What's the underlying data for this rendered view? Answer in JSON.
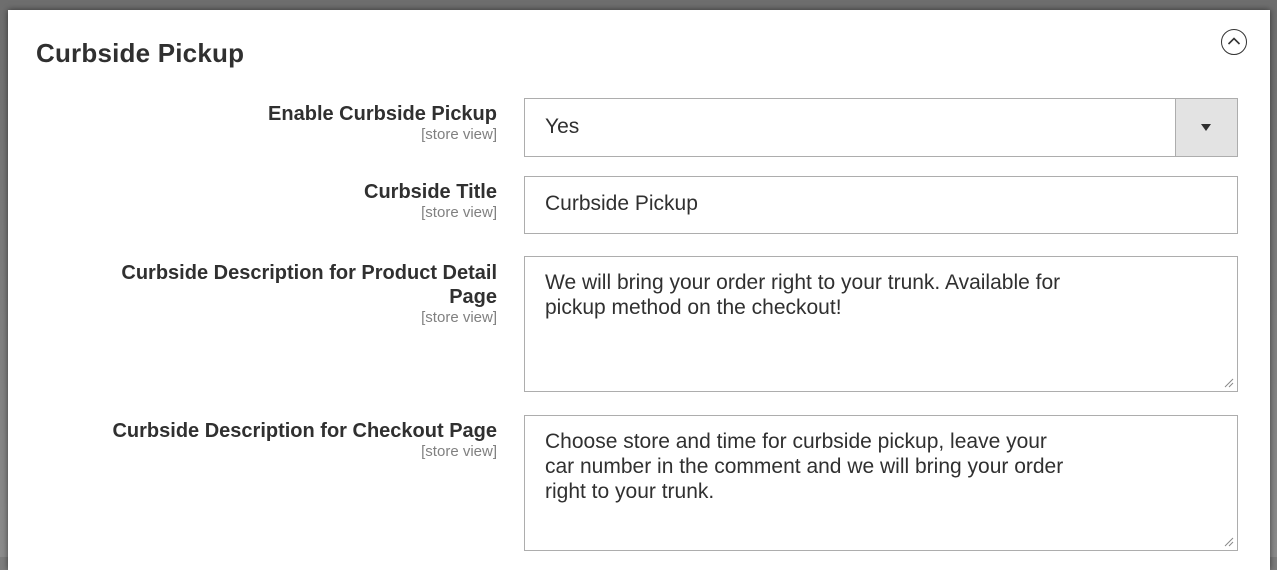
{
  "section": {
    "title": "Curbside Pickup"
  },
  "fields": {
    "enable": {
      "label": "Enable Curbside Pickup",
      "scope": "[store view]",
      "value": "Yes"
    },
    "title": {
      "label": "Curbside Title",
      "scope": "[store view]",
      "value": "Curbside Pickup"
    },
    "product_desc": {
      "label_line1": "Curbside Description for Product Detail",
      "label_line2": "Page",
      "scope": "[store view]",
      "value": "We will bring your order right to your trunk. Available for\npickup method on the checkout!"
    },
    "checkout_desc": {
      "label": "Curbside Description for Checkout Page",
      "scope": "[store view]",
      "value": "Choose store and time for curbside pickup, leave your\ncar number in the comment and we will bring your order\nright to your trunk."
    }
  },
  "icons": {
    "collapse": "chevron-up-circle-icon",
    "dropdown": "triangle-down-icon",
    "resize": "resize-grip-icon"
  }
}
